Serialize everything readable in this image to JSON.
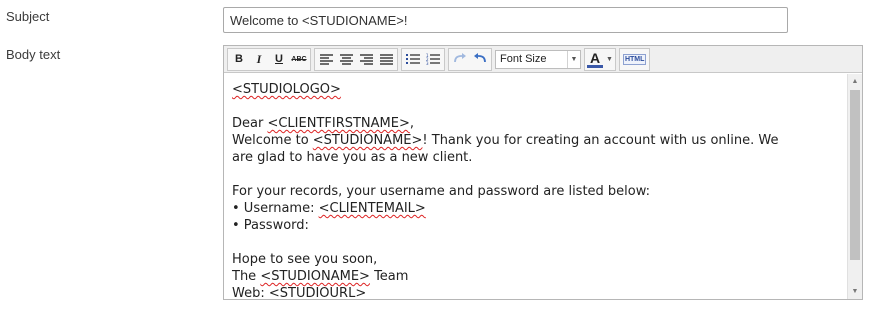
{
  "form": {
    "subject_label": "Subject",
    "subject_value": "Welcome to <STUDIONAME>!",
    "body_label": "Body text"
  },
  "toolbar": {
    "bold": "B",
    "italic": "I",
    "underline": "U",
    "strike": "ABC",
    "font_size": "Font Size",
    "font_color": "A",
    "html": "HTML"
  },
  "body": {
    "logo": "<STUDIOLOGO>",
    "dear": "Dear ",
    "client_first": "<CLIENTFIRSTNAME>",
    "comma": ",",
    "welcome": "Welcome to ",
    "studio1": "<STUDIONAME>",
    "welcome_rest": "! Thank you for creating an account with us online. We",
    "glad": "are glad to have you as a new client.",
    "records": "For your records, your username and password are listed below:",
    "username_prefix": "• Username: ",
    "client_email": "<CLIENTEMAIL>",
    "password": "• Password:",
    "hope": "Hope to see you soon,",
    "the": "The ",
    "studio2": "<STUDIONAME>",
    "team": " Team",
    "web_prefix": "Web: ",
    "studio_url": "<STUDIOURL>"
  },
  "colors": {
    "font_color_swatch": "#3a58a8",
    "spellcheck_underline": "#d22"
  }
}
